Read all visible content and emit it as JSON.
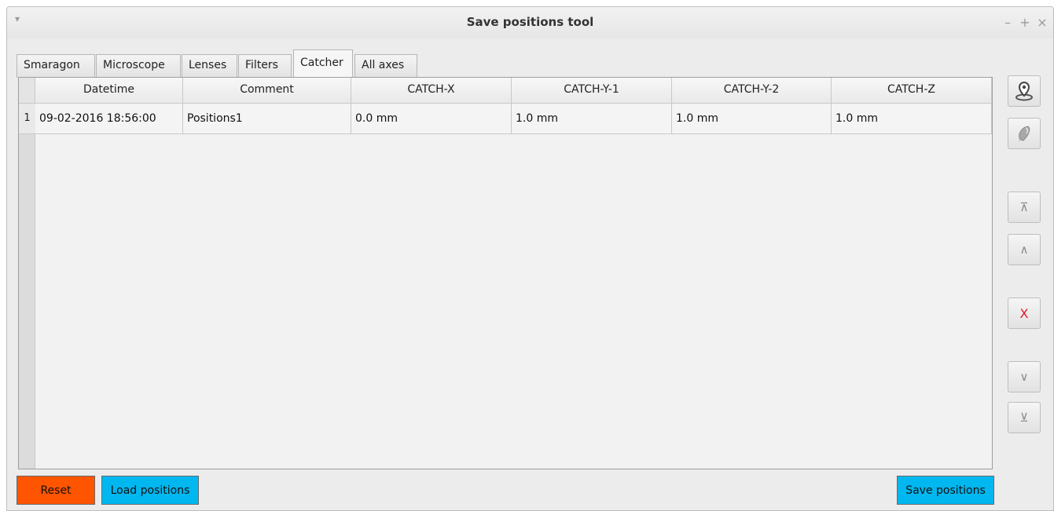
{
  "window": {
    "title": "Save positions tool",
    "controls": {
      "menu": "▾",
      "minimize": "–",
      "maximize": "+",
      "close": "×"
    }
  },
  "tabs": [
    {
      "label": "Smaragon",
      "active": false
    },
    {
      "label": "Microscope",
      "active": false
    },
    {
      "label": "Lenses",
      "active": false
    },
    {
      "label": "Filters",
      "active": false
    },
    {
      "label": "Catcher",
      "active": true
    },
    {
      "label": "All axes",
      "active": false
    }
  ],
  "table": {
    "columns": [
      "Datetime",
      "Comment",
      "CATCH-X",
      "CATCH-Y-1",
      "CATCH-Y-2",
      "CATCH-Z"
    ],
    "rows": [
      {
        "index": "1",
        "cells": [
          "09-02-2016 18:56:00",
          "Positions1",
          "0.0 mm",
          "1.0 mm",
          "1.0 mm",
          "1.0 mm"
        ]
      }
    ]
  },
  "side_buttons": {
    "load_here": "map-pin-icon",
    "go_to": "probe-icon",
    "move_top": "⊼",
    "move_up": "∧",
    "delete": "X",
    "move_down": "∨",
    "move_bottom": "⊻"
  },
  "buttons": {
    "reset": "Reset",
    "load_positions": "Load positions",
    "save_positions": "Save positions"
  },
  "colors": {
    "reset_bg": "#ff5400",
    "load_bg": "#00b7ef",
    "save_bg": "#00b7ef",
    "delete_fg": "#e4162b"
  }
}
